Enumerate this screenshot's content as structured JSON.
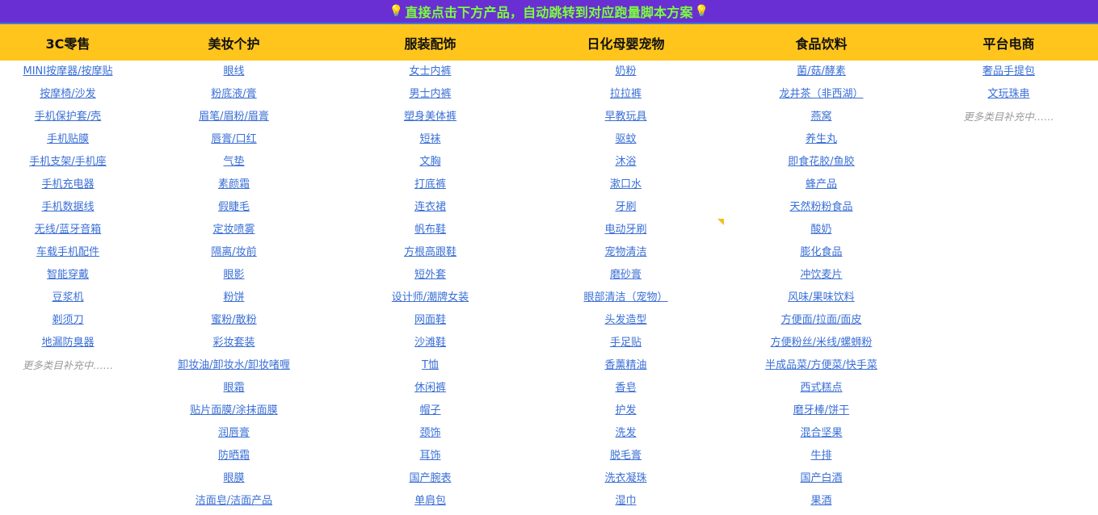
{
  "banner": {
    "text": "直接点击下方产品，自动跳转到对应跑量脚本方案",
    "left_icon": "bulb-icon",
    "right_icon": "bulb-icon",
    "icon_glyph": "💡",
    "text_color": "#79ff3c",
    "bg_color": "#6a2fd3"
  },
  "header_bg": "#ffc51c",
  "link_color": "#3a6fd6",
  "columns": [
    {
      "title": "3C零售",
      "items": [
        "MINI按摩器/按摩贴",
        "按摩椅/沙发",
        "手机保护套/壳",
        "手机贴膜",
        "手机支架/手机座",
        "手机充电器",
        "手机数据线",
        "无线/蓝牙音箱",
        "车载手机配件",
        "智能穿戴",
        "豆浆机",
        "剃须刀",
        "地漏防臭器"
      ],
      "more": "更多类目补充中……"
    },
    {
      "title": "美妆个护",
      "items": [
        "眼线",
        "粉底液/膏",
        "眉笔/眉粉/眉膏",
        "唇膏/口红",
        "气垫",
        "素颜霜",
        "假睫毛",
        "定妆喷雾",
        "隔离/妆前",
        "眼影",
        "粉饼",
        "蜜粉/散粉",
        "彩妆套装",
        "卸妆油/卸妆水/卸妆啫喱",
        "眼霜",
        "贴片面膜/涂抹面膜",
        "润唇膏",
        "防晒霜",
        "眼膜",
        "洁面皂/洁面产品"
      ]
    },
    {
      "title": "服装配饰",
      "items": [
        "女士内裤",
        "男士内裤",
        "塑身美体裤",
        "短袜",
        "文胸",
        "打底裤",
        "连衣裙",
        "帆布鞋",
        "方根高跟鞋",
        "短外套",
        "设计师/潮牌女装",
        "网面鞋",
        "沙滩鞋",
        "T恤",
        "休闲裤",
        "帽子",
        "颈饰",
        "耳饰",
        "国产腕表",
        "单肩包"
      ]
    },
    {
      "title": "日化母婴宠物",
      "items": [
        "奶粉",
        "拉拉裤",
        "早教玩具",
        "驱蚊",
        "沐浴",
        "漱口水",
        "牙刷",
        "电动牙刷",
        "宠物清洁",
        "磨砂膏",
        "眼部清洁（宠物）",
        "头发造型",
        "手足贴",
        "香薰精油",
        "香皂",
        "护发",
        "洗发",
        "脱毛膏",
        "洗衣凝珠",
        "湿巾"
      ]
    },
    {
      "title": "食品饮料",
      "items": [
        "菌/菇/酵素",
        "龙井茶（非西湖）",
        "燕窝",
        "养生丸",
        "即食花胶/鱼胶",
        "蜂产品",
        "天然粉粉食品",
        "酸奶",
        "膨化食品",
        "冲饮麦片",
        "风味/果味饮料",
        "方便面/拉面/面皮",
        "方便粉丝/米线/螺蛳粉",
        "半成品菜/方便菜/快手菜",
        "西式糕点",
        "磨牙棒/饼干",
        "混合坚果",
        "牛排",
        "国产白酒",
        "果酒"
      ]
    },
    {
      "title": "平台电商",
      "items": [
        "奢品手提包",
        "文玩珠串"
      ],
      "more": "更多类目补充中……"
    }
  ]
}
